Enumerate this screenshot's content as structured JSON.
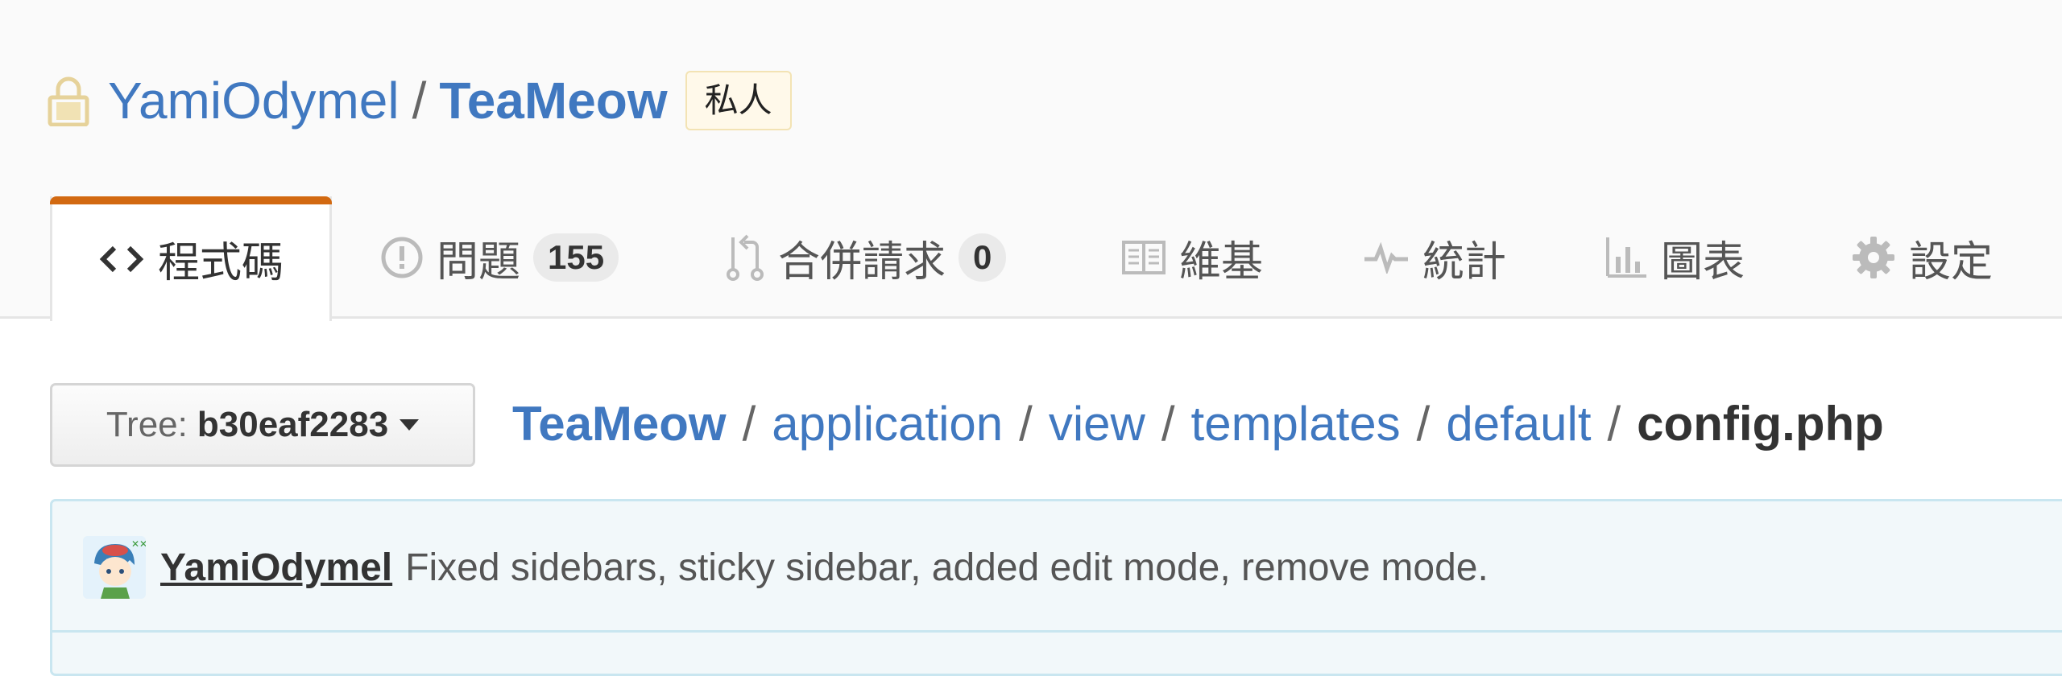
{
  "repo": {
    "owner": "YamiOdymel",
    "separator": "/",
    "name": "TeaMeow",
    "visibility_label": "私人"
  },
  "tabs": [
    {
      "label": "程式碼",
      "icon": "code-icon",
      "selected": true
    },
    {
      "label": "問題",
      "icon": "issue-opened-icon",
      "counter": "155"
    },
    {
      "label": "合併請求",
      "icon": "git-pull-request-icon",
      "counter": "0"
    },
    {
      "label": "維基",
      "icon": "book-icon"
    },
    {
      "label": "統計",
      "icon": "pulse-icon"
    },
    {
      "label": "圖表",
      "icon": "graph-icon"
    },
    {
      "label": "設定",
      "icon": "gear-icon"
    }
  ],
  "tree_button": {
    "label": "Tree:",
    "sha": "b30eaf2283"
  },
  "breadcrumb": {
    "separator": "/",
    "parts": [
      "TeaMeow",
      "application",
      "view",
      "templates",
      "default"
    ],
    "final": "config.php"
  },
  "commit": {
    "author": "YamiOdymel",
    "message": "Fixed sidebars, sticky sidebar, added edit mode, remove mode."
  },
  "colors": {
    "link": "#4078c0",
    "tab_accent": "#d26911",
    "private_bg": "#fff9ea",
    "commit_bg": "#f2f8fa"
  }
}
